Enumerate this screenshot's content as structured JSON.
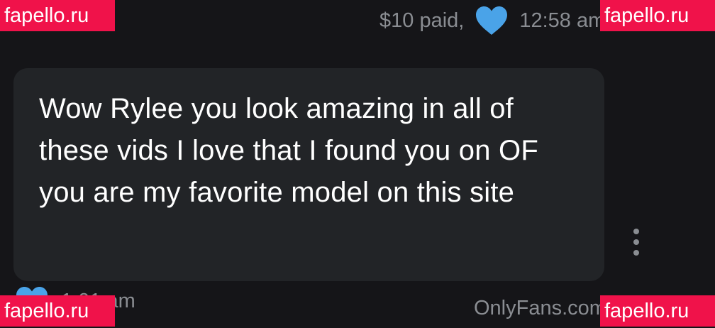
{
  "message_meta": {
    "price": "$10 paid,",
    "time": "12:58 am",
    "heart_icon": "heart-icon",
    "heart_color": "#4aa3e8"
  },
  "message": {
    "text": "Wow Rylee you look amazing in all of these vids I love that I found you on OF you are my favorite model on this site",
    "more_icon": "more-vertical-icon"
  },
  "reply_meta": {
    "time": "1:01 am",
    "heart_icon": "heart-icon"
  },
  "site_watermark": "OnlyFans.com",
  "watermarks": {
    "tl": "fapello.ru",
    "tr": "fapello.ru",
    "bl": "fapello.ru",
    "br": "fapello.ru",
    "color": "#f0124a"
  }
}
